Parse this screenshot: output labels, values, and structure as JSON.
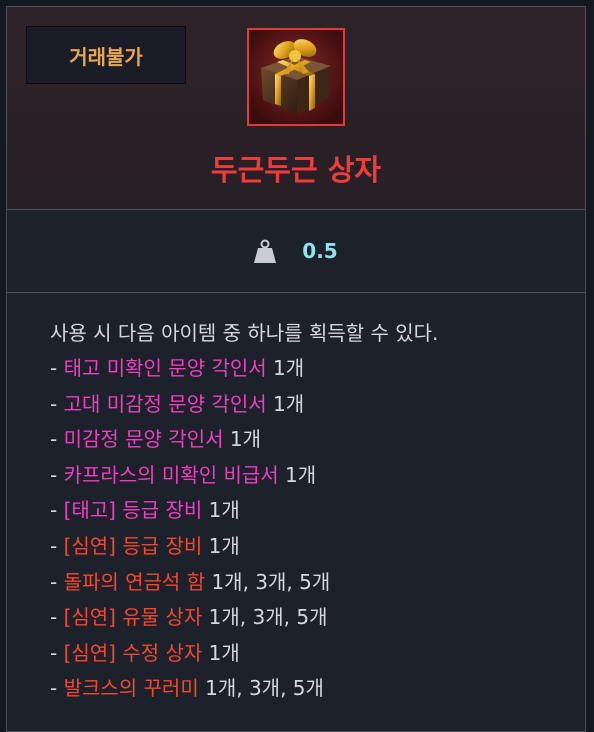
{
  "colors": {
    "accent_name": "#ef3c3a",
    "trade_badge": "#e9a64e",
    "weight": "#8fe2ee",
    "pink_item": "#f03fbf",
    "orange_item": "#f5482c"
  },
  "header": {
    "trade_badge": "거래불가",
    "item_icon": "gift-box-icon",
    "item_name": "두근두근 상자"
  },
  "weight": {
    "icon": "weight-icon",
    "value": "0.5"
  },
  "description": {
    "intro": "사용 시 다음 아이템 중 하나를 획득할 수 있다.",
    "items": [
      {
        "name": "태고 미확인 문양 각인서",
        "qty": "1개",
        "color": "pink"
      },
      {
        "name": "고대 미감정 문양 각인서",
        "qty": "1개",
        "color": "pink"
      },
      {
        "name": "미감정 문양 각인서",
        "qty": "1개",
        "color": "pink"
      },
      {
        "name": "카프라스의 미확인 비급서",
        "qty": "1개",
        "color": "pink"
      },
      {
        "name": "[태고] 등급 장비",
        "qty": "1개",
        "color": "pink"
      },
      {
        "name": "[심연] 등급 장비",
        "qty": "1개",
        "color": "orange"
      },
      {
        "name": "돌파의 연금석 함",
        "qty": "1개, 3개, 5개",
        "color": "orange"
      },
      {
        "name": "[심연] 유물 상자",
        "qty": "1개, 3개, 5개",
        "color": "orange"
      },
      {
        "name": "[심연] 수정 상자",
        "qty": "1개",
        "color": "orange"
      },
      {
        "name": "발크스의 꾸러미",
        "qty": "1개, 3개, 5개",
        "color": "orange"
      }
    ]
  }
}
